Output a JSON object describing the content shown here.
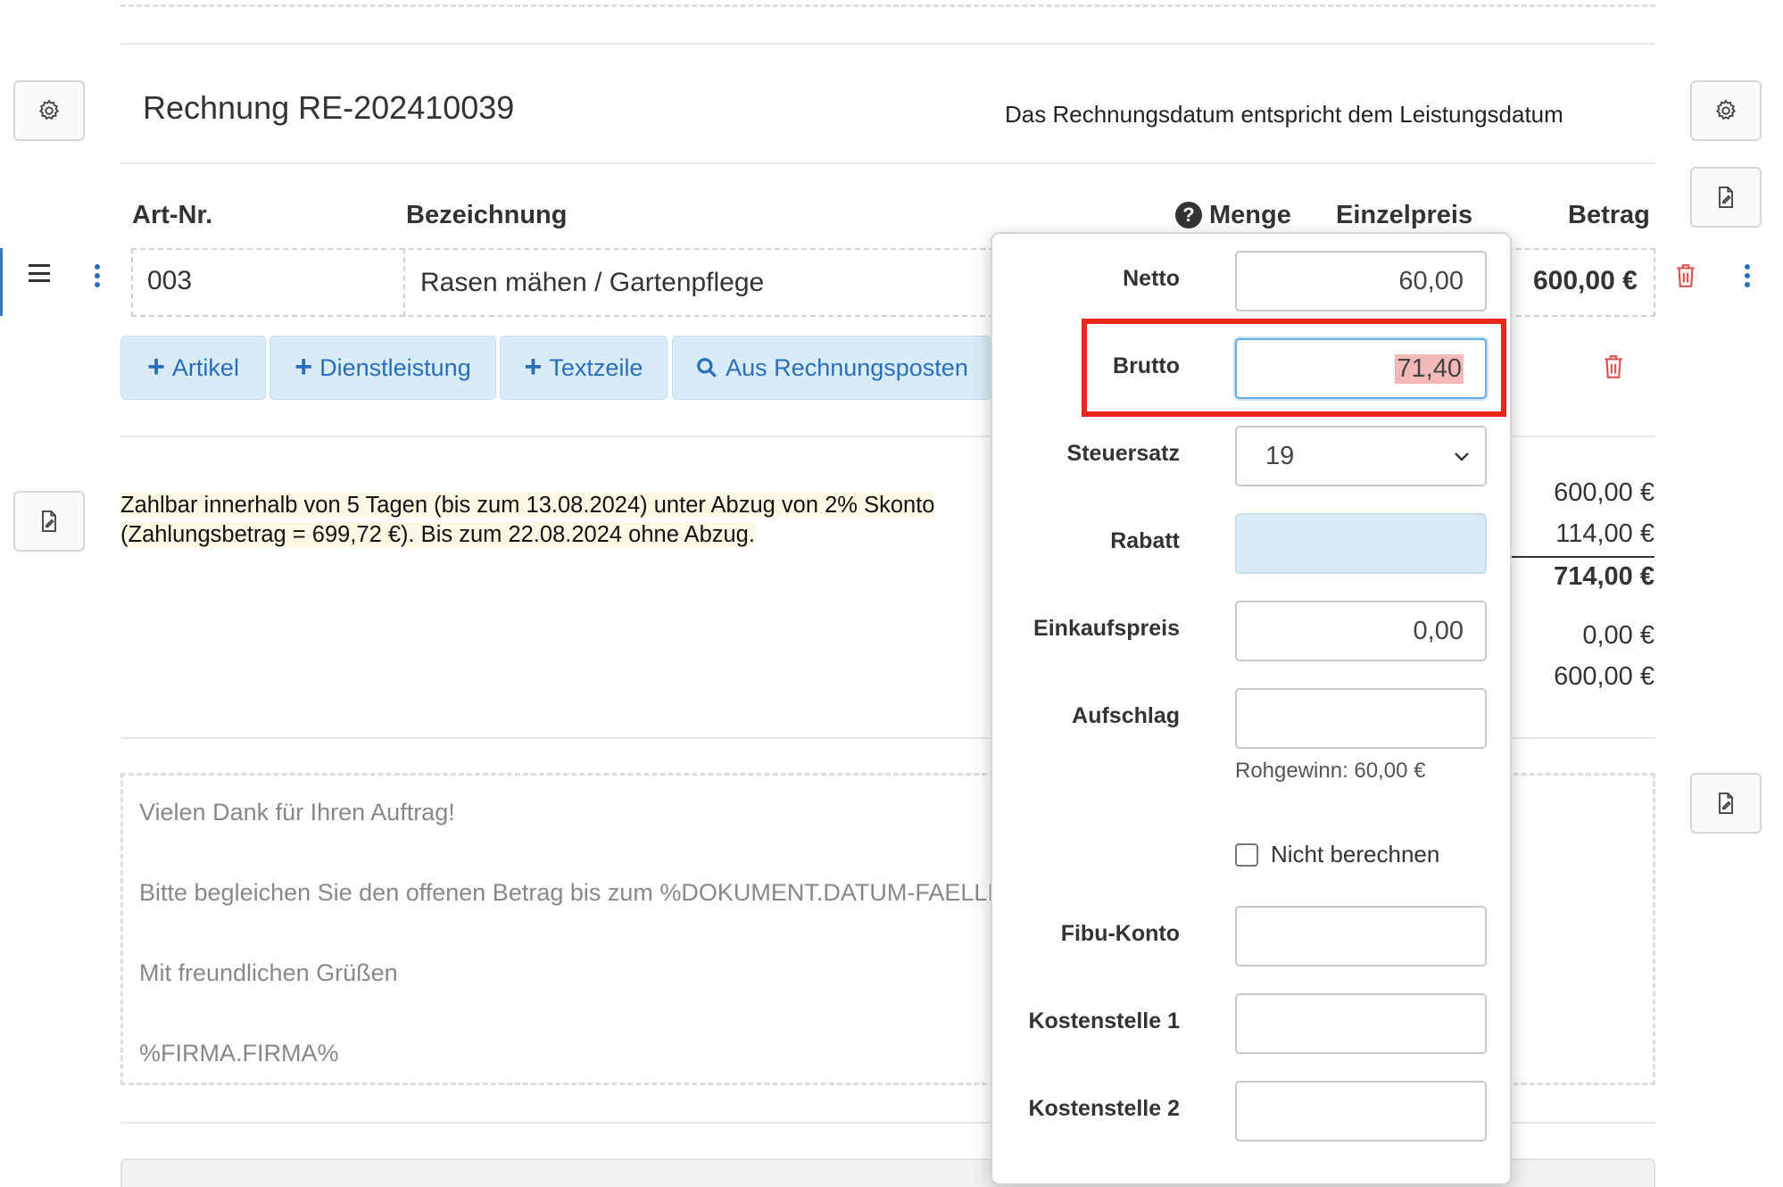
{
  "document": {
    "title": "Rechnung RE-202410039",
    "date_note": "Das Rechnungsdatum entspricht dem Leistungsdatum"
  },
  "table": {
    "headers": {
      "art_nr": "Art-Nr.",
      "bezeichnung": "Bezeichnung",
      "menge": "Menge",
      "einzelpreis": "Einzelpreis",
      "betrag": "Betrag"
    },
    "rows": [
      {
        "art_nr": "003",
        "bezeichnung": "Rasen mähen / Gartenpflege",
        "betrag": "600,00 €"
      }
    ]
  },
  "add_buttons": {
    "artikel": "Artikel",
    "dienstleistung": "Dienstleistung",
    "textzeile": "Textzeile",
    "aus_rechnungsposten": "Aus Rechnungsposten"
  },
  "payment_terms": {
    "line1": "Zahlbar innerhalb von 5 Tagen (bis zum 13.08.2024) unter Abzug von 2% Skonto",
    "line2": "(Zahlungsbetrag = 699,72 €). Bis zum 22.08.2024 ohne Abzug."
  },
  "totals": {
    "netto": "600,00 €",
    "steuer": "114,00 €",
    "brutto": "714,00 €",
    "extra1": "0,00 €",
    "extra2": "600,00 €"
  },
  "footer_text": {
    "line1": "Vielen Dank für Ihren Auftrag!",
    "line2": "Bitte begleichen Sie den offenen Betrag bis zum %DOKUMENT.DATUM-FAELLIG%",
    "line3": "Mit freundlichen Grüßen",
    "line4": "%FIRMA.FIRMA%"
  },
  "popover": {
    "netto_label": "Netto",
    "netto_value": "60,00",
    "brutto_label": "Brutto",
    "brutto_value": "71,40",
    "steuersatz_label": "Steuersatz",
    "steuersatz_value": "19",
    "rabatt_label": "Rabatt",
    "rabatt_value": "",
    "einkaufspreis_label": "Einkaufspreis",
    "einkaufspreis_value": "0,00",
    "aufschlag_label": "Aufschlag",
    "aufschlag_value": "",
    "rohgewinn": "Rohgewinn: 60,00 €",
    "nicht_berechnen": "Nicht berechnen",
    "fibu_konto_label": "Fibu-Konto",
    "kostenstelle1_label": "Kostenstelle 1",
    "kostenstelle2_label": "Kostenstelle 2"
  },
  "icons": {
    "settings": "gear-icon",
    "document_edit": "file-edit-icon",
    "delete": "trash-icon",
    "menu": "hamburger-icon",
    "more": "vertical-dots-icon",
    "help": "question-circle-icon",
    "search": "search-icon",
    "dropdown": "chevron-down-icon"
  },
  "colors": {
    "accent_blue": "#2a6ebb",
    "button_bg": "#d8ecf7",
    "highlight_red": "#e8271f",
    "delete_red": "#d9534f",
    "note_bg": "#fcf8e3"
  }
}
